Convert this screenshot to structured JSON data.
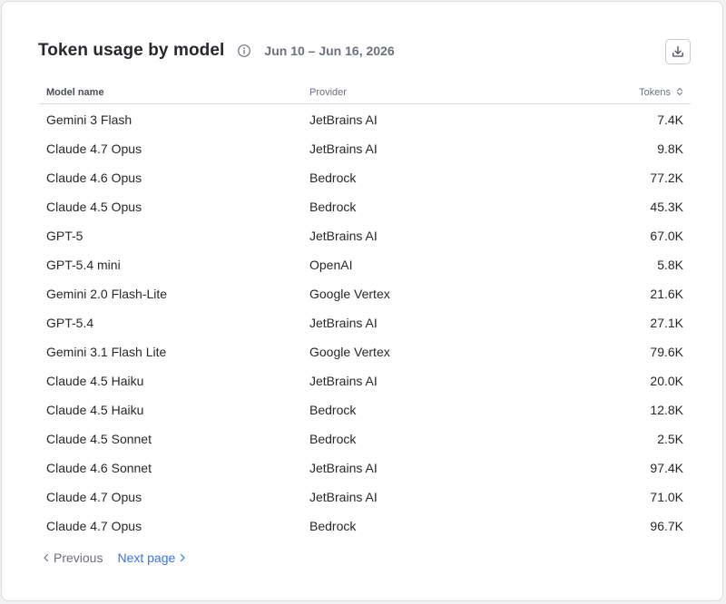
{
  "header": {
    "title": "Token usage by model",
    "date_range": "Jun 10 – Jun 16, 2026"
  },
  "icons": {
    "info": "info-icon",
    "download": "download-icon",
    "sort": "sort-icon",
    "prev": "chevron-left-icon",
    "next": "chevron-right-icon"
  },
  "table": {
    "columns": {
      "model": "Model name",
      "provider": "Provider",
      "tokens": "Tokens"
    },
    "rows": [
      {
        "model": "Gemini 3 Flash",
        "provider": "JetBrains AI",
        "tokens": "7.4K"
      },
      {
        "model": "Claude 4.7 Opus",
        "provider": "JetBrains AI",
        "tokens": "9.8K"
      },
      {
        "model": "Claude 4.6 Opus",
        "provider": "Bedrock",
        "tokens": "77.2K"
      },
      {
        "model": "Claude 4.5 Opus",
        "provider": "Bedrock",
        "tokens": "45.3K"
      },
      {
        "model": "GPT-5",
        "provider": "JetBrains AI",
        "tokens": "67.0K"
      },
      {
        "model": "GPT-5.4 mini",
        "provider": "OpenAI",
        "tokens": "5.8K"
      },
      {
        "model": "Gemini 2.0 Flash-Lite",
        "provider": "Google Vertex",
        "tokens": "21.6K"
      },
      {
        "model": "GPT-5.4",
        "provider": "JetBrains AI",
        "tokens": "27.1K"
      },
      {
        "model": "Gemini 3.1 Flash Lite",
        "provider": "Google Vertex",
        "tokens": "79.6K"
      },
      {
        "model": "Claude 4.5 Haiku",
        "provider": "JetBrains AI",
        "tokens": "20.0K"
      },
      {
        "model": "Claude 4.5 Haiku",
        "provider": "Bedrock",
        "tokens": "12.8K"
      },
      {
        "model": "Claude 4.5 Sonnet",
        "provider": "Bedrock",
        "tokens": "2.5K"
      },
      {
        "model": "Claude 4.6 Sonnet",
        "provider": "JetBrains AI",
        "tokens": "97.4K"
      },
      {
        "model": "Claude 4.7 Opus",
        "provider": "JetBrains AI",
        "tokens": "71.0K"
      },
      {
        "model": "Claude 4.7 Opus",
        "provider": "Bedrock",
        "tokens": "96.7K"
      }
    ]
  },
  "pager": {
    "previous_label": "Previous",
    "next_label": "Next page"
  },
  "colors": {
    "link": "#3574f0",
    "muted": "#6c707e",
    "text": "#27282c"
  }
}
